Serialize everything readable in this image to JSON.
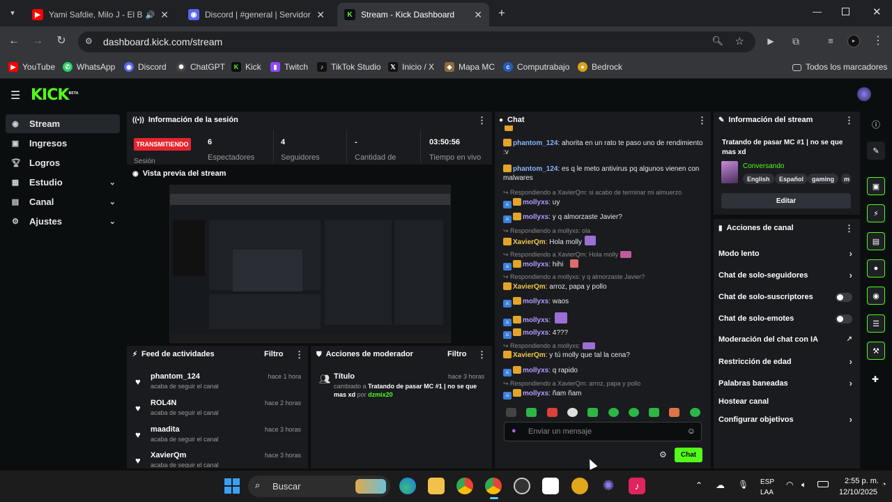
{
  "browser": {
    "tabs": [
      {
        "title": "Yami Safdie, Milo J - El Bolero",
        "icon": "youtube-icon",
        "color": "#ff0000"
      },
      {
        "title": "Discord | #general | Servidor De",
        "icon": "discord-icon",
        "color": "#5865f2"
      },
      {
        "title": "Stream - Kick Dashboard",
        "icon": "kick-icon",
        "color": "#53fc18"
      }
    ],
    "url": "dashboard.kick.com/stream",
    "bookmarks": [
      "YouTube",
      "WhatsApp",
      "Discord",
      "ChatGPT",
      "Kick",
      "Twitch",
      "TikTok Studio",
      "Inicio / X",
      "Mapa MC",
      "Computrabajo",
      "Bedrock"
    ],
    "all_bookmarks": "Todos los marcadores"
  },
  "app": {
    "logo": "KICK",
    "logo_sup": "BETA",
    "sidebar": [
      {
        "label": "Stream",
        "icon": "broadcast-icon"
      },
      {
        "label": "Ingresos",
        "icon": "wallet-icon"
      },
      {
        "label": "Logros",
        "icon": "trophy-icon"
      },
      {
        "label": "Estudio",
        "icon": "studio-icon"
      },
      {
        "label": "Canal",
        "icon": "channel-icon"
      },
      {
        "label": "Ajustes",
        "icon": "gear-icon"
      }
    ],
    "session": {
      "title": "Información de la sesión",
      "status": "TRANSMITIENDO",
      "status_label": "Sesión",
      "stats": [
        {
          "value": "6",
          "label": "Espectadores"
        },
        {
          "value": "4",
          "label": "Seguidores"
        },
        {
          "value": "-",
          "label": "Cantidad de"
        },
        {
          "value": "03:50:56",
          "label": "Tiempo en vivo"
        }
      ]
    },
    "preview": {
      "title": "Vista previa del stream"
    },
    "activity": {
      "title": "Feed de actividades",
      "filter": "Filtro",
      "items": [
        {
          "name": "phantom_124",
          "action": "acaba de seguir el canal",
          "time": "hace 1 hora"
        },
        {
          "name": "ROL4N",
          "action": "acaba de seguir el canal",
          "time": "hace 2 horas"
        },
        {
          "name": "maadita",
          "action": "acaba de seguir el canal",
          "time": "hace 3 horas"
        },
        {
          "name": "XavierQm",
          "action": "acaba de seguir el canal",
          "time": "hace 3 horas"
        }
      ]
    },
    "moderator": {
      "title": "Acciones de moderador",
      "filter": "Filtro",
      "item": {
        "label": "Título",
        "time": "hace 3 horas",
        "prefix": "cambiado a",
        "value": "Tratando de pasar MC #1 | no se que mas xd",
        "by": "por",
        "user": "dzmix20"
      }
    },
    "chat": {
      "title": "Chat",
      "messages": [
        {
          "user": "phantom_124",
          "text": ": ahorita en un rato te paso uno de rendimiento :v"
        },
        {
          "user": "phantom_124",
          "text": ": es q le meto antivirus pq algunos vienen con malwares"
        },
        {
          "reply": "Respondiendo a XavierQm: si acabo de terminar mi almuerzo"
        },
        {
          "user": "mollyxs",
          "text": ": uy"
        },
        {
          "user": "mollyxs",
          "text": ": y q almorzaste Javier?"
        },
        {
          "reply": "Respondiendo a mollyxs: ola"
        },
        {
          "user": "XavierQm",
          "text": ": Hola molly"
        },
        {
          "reply": "Respondiendo a XavierQm: Hola molly"
        },
        {
          "user": "mollyxs",
          "text": ": hihi"
        },
        {
          "reply": "Respondiendo a mollyxs: y q almorzaste Javier?"
        },
        {
          "user": "XavierQm",
          "text": ": arroz, papa y pollo"
        },
        {
          "user": "mollyxs",
          "text": ": waos"
        },
        {
          "user": "mollyxs",
          "text": ":"
        },
        {
          "user": "mollyxs",
          "text": ": 4???"
        },
        {
          "reply": "Respondiendo a mollyxs:"
        },
        {
          "user": "XavierQm",
          "text": ": y tú molly que tal la cena?"
        },
        {
          "user": "mollyxs",
          "text": ": q rapido"
        },
        {
          "reply": "Respondiendo a XavierQm: arroz, papa y pollo"
        },
        {
          "user": "mollyxs",
          "text": ": ñam ñam"
        }
      ],
      "placeholder": "Enviar un mensaje",
      "send": "Chat"
    },
    "stream_info": {
      "title": "Información del stream",
      "stream_title": "Tratando de pasar MC #1 | no se que mas xd",
      "category": "Conversando",
      "tags": [
        "English",
        "Español",
        "gaming",
        "m"
      ],
      "edit": "Editar"
    },
    "channel_actions": {
      "title": "Acciones de canal",
      "items": [
        {
          "label": "Modo lento",
          "control": "arrow"
        },
        {
          "label": "Chat de solo-seguidores",
          "control": "arrow"
        },
        {
          "label": "Chat de solo-suscriptores",
          "control": "toggle"
        },
        {
          "label": "Chat de solo-emotes",
          "control": "toggle"
        },
        {
          "label": "Moderación del chat con IA",
          "control": "external"
        },
        {
          "label": "Restricción de edad",
          "control": "arrow"
        },
        {
          "label": "Palabras baneadas",
          "control": "arrow"
        },
        {
          "label": "Hostear canal",
          "control": "none"
        },
        {
          "label": "Configurar objetivos",
          "control": "arrow"
        }
      ]
    }
  },
  "taskbar": {
    "search": "Buscar",
    "lang1": "ESP",
    "lang2": "LAA",
    "time": "2:55 p. m.",
    "date": "12/10/2025"
  },
  "colors": {
    "kick_green": "#53fc18",
    "live_red": "#e5252e",
    "panel": "#191b1f"
  }
}
